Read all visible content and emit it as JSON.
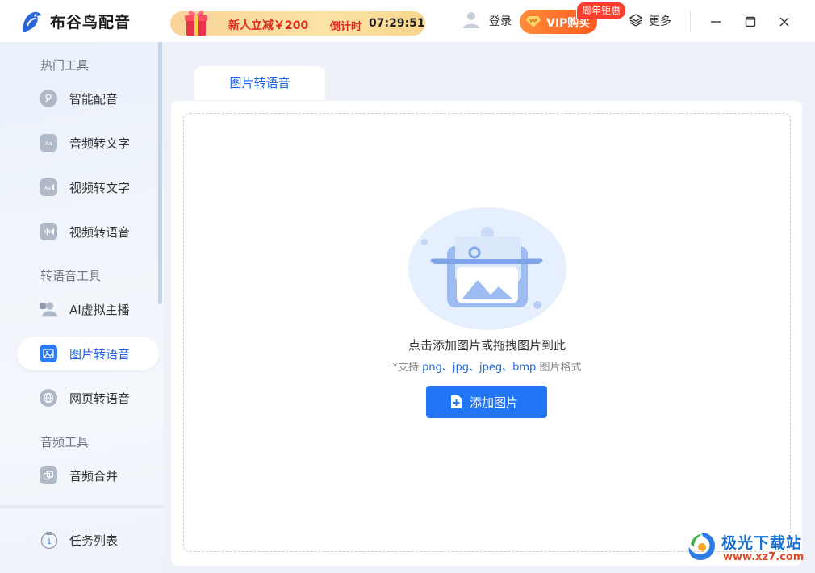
{
  "app": {
    "title": "布谷鸟配音"
  },
  "header": {
    "promo_text": "新人立减￥200",
    "countdown_label": "倒计时",
    "countdown_value": "07:29:51",
    "login_label": "登录",
    "vip_label": "VIP购买",
    "vip_tag": "周年钜惠",
    "more_label": "更多"
  },
  "sidebar": {
    "sections": [
      {
        "title": "热门工具",
        "items": [
          {
            "label": "智能配音",
            "icon": "mic-icon"
          },
          {
            "label": "音频转文字",
            "icon": "audio-to-text-icon"
          },
          {
            "label": "视频转文字",
            "icon": "video-to-text-icon"
          },
          {
            "label": "视频转语音",
            "icon": "video-to-voice-icon"
          }
        ]
      },
      {
        "title": "转语音工具",
        "items": [
          {
            "label": "AI虚拟主播",
            "icon": "virtual-anchor-icon"
          },
          {
            "label": "图片转语音",
            "icon": "image-icon",
            "active": true
          },
          {
            "label": "网页转语音",
            "icon": "globe-icon"
          }
        ]
      },
      {
        "title": "音频工具",
        "items": [
          {
            "label": "音频合并",
            "icon": "merge-icon"
          }
        ]
      }
    ],
    "task_list_label": "任务列表",
    "task_list_count": "1"
  },
  "main": {
    "tab_label": "图片转语音",
    "drop_hint": "点击添加图片或拖拽图片到此",
    "format_prefix": "*支持 ",
    "formats": "png、jpg、jpeg、bmp",
    "format_suffix": " 图片格式",
    "add_button_label": "添加图片"
  },
  "watermark": {
    "name": "极光下载站",
    "url": "www.xz7.com"
  },
  "colors": {
    "accent": "#2276f5",
    "active_text": "#1c66e3",
    "vip_orange": "#ff6a26",
    "promo_red": "#e0291f"
  }
}
